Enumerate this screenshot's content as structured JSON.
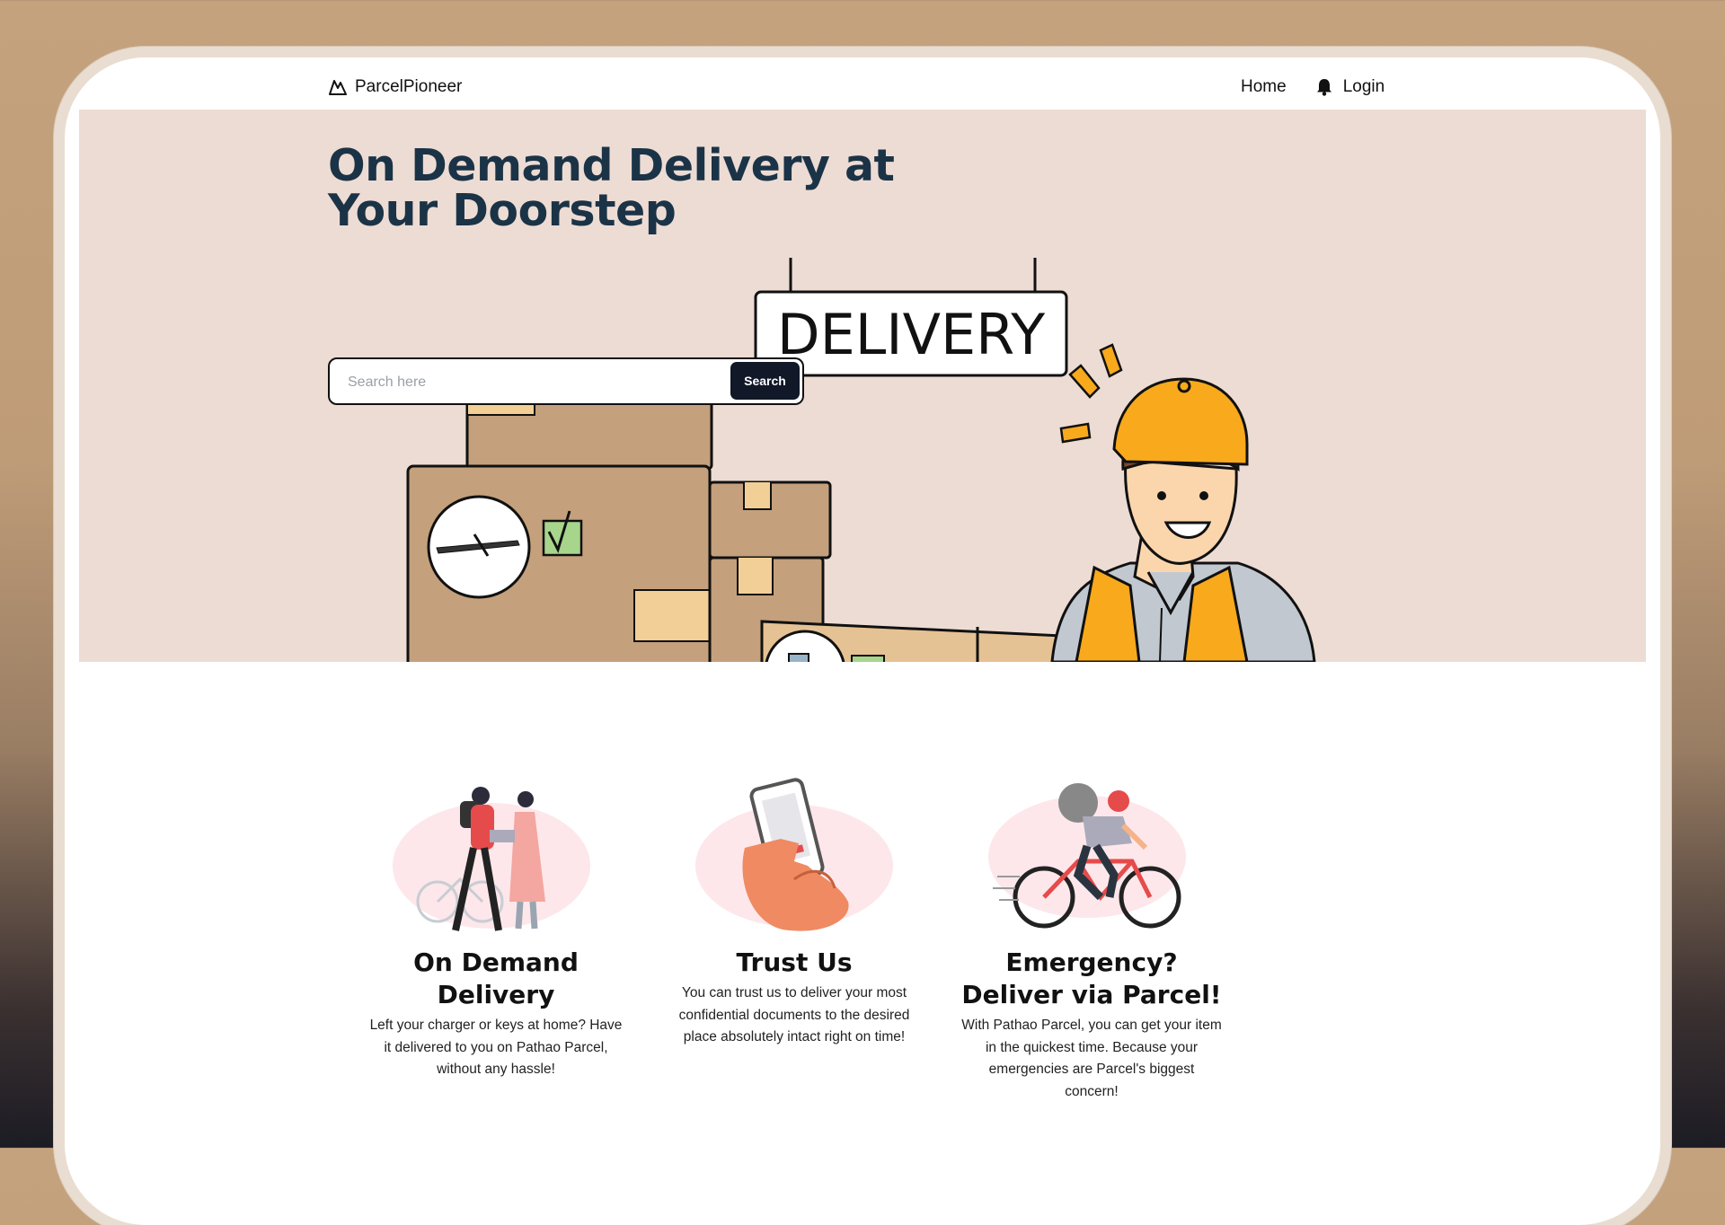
{
  "nav": {
    "brand": "ParcelPioneer",
    "links": {
      "home": "Home",
      "login": "Login"
    }
  },
  "hero": {
    "title": "On Demand Delivery at Your Doorstep",
    "sign_text": "DELIVERY",
    "search": {
      "placeholder": "Search here",
      "button_label": "Search"
    }
  },
  "features": [
    {
      "title": "On Demand Delivery",
      "description": "Left your charger or keys at home? Have it delivered to you on Pathao Parcel, without any hassle!"
    },
    {
      "title": "Trust Us",
      "description": "You can trust us to deliver your most confidential documents to the desired place absolutely intact right on time!"
    },
    {
      "title": "Emergency? Deliver via Parcel!",
      "description": "With Pathao Parcel, you can get your item in the quickest time. Because your emergencies are Parcel's biggest concern!"
    }
  ],
  "colors": {
    "hero_bg": "#eddcd4",
    "title": "#1b3346",
    "button": "#111827",
    "box": "#c4a07c",
    "cap": "#f8a91c"
  },
  "icons": [
    "mountain-logo-icon",
    "bell-icon"
  ]
}
